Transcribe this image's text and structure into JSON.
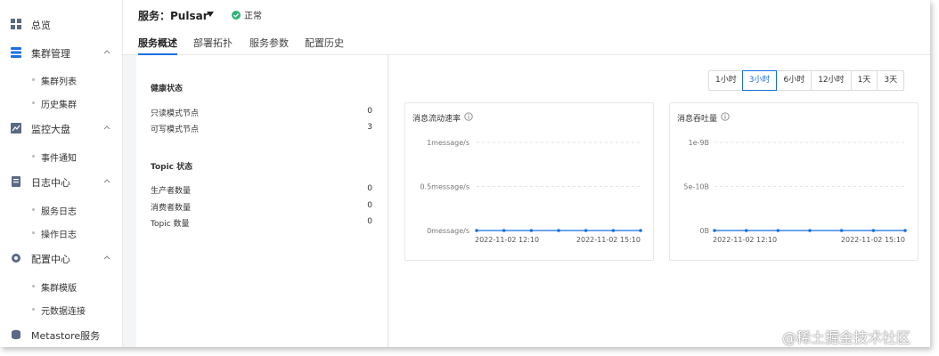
{
  "sidebar": {
    "overview": "总览",
    "cluster_mgmt": "集群管理",
    "cluster_list": "集群列表",
    "history_cluster": "历史集群",
    "monitor": "监控大盘",
    "event_notify": "事件通知",
    "log_center": "日志中心",
    "service_log": "服务日志",
    "operation_log": "操作日志",
    "config_center": "配置中心",
    "cluster_template": "集群模版",
    "metadata_conn": "元数据连接",
    "metastore": "Metastore服务"
  },
  "header": {
    "service_title": "服务：Pulsar",
    "status": "正常",
    "tabs": [
      "服务概述",
      "部署拓扑",
      "服务参数",
      "配置历史"
    ]
  },
  "overview": {
    "health_title": "健康状态",
    "readonly_nodes_label": "只读模式节点",
    "readonly_nodes_value": "0",
    "writable_nodes_label": "可写模式节点",
    "writable_nodes_value": "3",
    "topic_title": "Topic 状态",
    "producers_label": "生产者数量",
    "producers_value": "0",
    "consumers_label": "消费者数量",
    "consumers_value": "0",
    "topics_label": "Topic 数量",
    "topics_value": "0"
  },
  "time_range": {
    "options": [
      "1小时",
      "3小时",
      "6小时",
      "12小时",
      "1天",
      "3天"
    ],
    "selected": "3小时"
  },
  "chart_data": [
    {
      "type": "line",
      "title": "消息流动速率",
      "yticks": [
        "1message/s",
        "0.5message/s",
        "0message/s"
      ],
      "xticks": [
        "2022-11-02 12:10",
        "2022-11-02 15:10"
      ],
      "ylim": [
        0,
        1
      ],
      "series": [
        {
          "values": [
            0,
            0,
            0,
            0,
            0,
            0,
            0
          ]
        }
      ],
      "grid": true,
      "color": "#1a6fe0"
    },
    {
      "type": "line",
      "title": "消息吞吐量",
      "yticks": [
        "1e-9B",
        "5e-10B",
        "0B"
      ],
      "xticks": [
        "2022-11-02 12:10",
        "2022-11-02 15:10"
      ],
      "ylim": [
        0,
        1e-09
      ],
      "series": [
        {
          "values": [
            0,
            0,
            0,
            0,
            0,
            0,
            0
          ]
        }
      ],
      "grid": true,
      "color": "#1a6fe0"
    }
  ],
  "watermark": "@稀土掘金技术社区",
  "colors": {
    "accent": "#1a6fe0",
    "ok": "#2bb673"
  }
}
